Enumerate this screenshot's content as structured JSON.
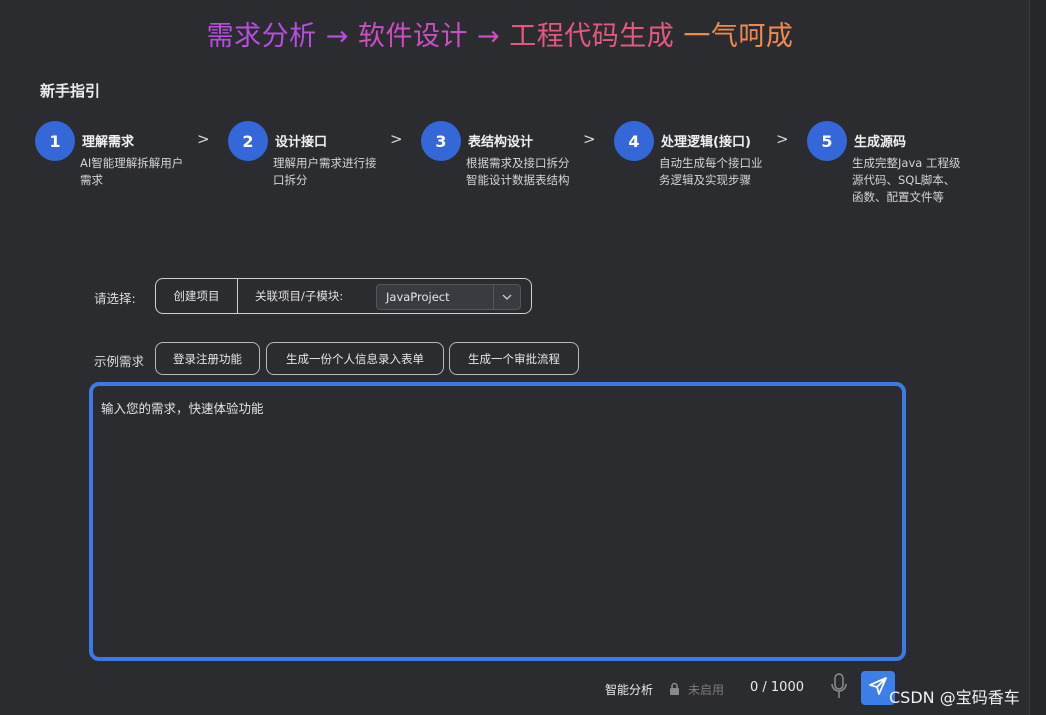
{
  "headline": {
    "part1": "需求分析 → ",
    "part2": "软件设计 → ",
    "part3": "工程代码生成 ",
    "part4": "一气呵成"
  },
  "guide": {
    "title": "新手指引",
    "steps": [
      {
        "num": "1",
        "name": "理解需求",
        "desc": "AI智能理解拆解用户需求"
      },
      {
        "num": "2",
        "name": "设计接口",
        "desc": "理解用户需求进行接口拆分"
      },
      {
        "num": "3",
        "name": "表结构设计",
        "desc": "根据需求及接口拆分智能设计数据表结构"
      },
      {
        "num": "4",
        "name": "处理逻辑(接口)",
        "desc": "自动生成每个接口业务逻辑及实现步骤"
      },
      {
        "num": "5",
        "name": "生成源码",
        "desc": "生成完整Java 工程级源代码、SQL脚本、函数、配置文件等"
      }
    ],
    "arrow": ">"
  },
  "select": {
    "label": "请选择:",
    "create_label": "创建项目",
    "link_label": "关联项目/子模块:",
    "dropdown_value": "JavaProject"
  },
  "examples": {
    "label": "示例需求",
    "chips": [
      "登录注册功能",
      "生成一份个人信息录入表单",
      "生成一个审批流程"
    ]
  },
  "prompt": {
    "placeholder": "输入您的需求，快速体验功能"
  },
  "footer": {
    "smart_label": "智能分析",
    "disabled_label": "未启用",
    "count": "0 / 1000"
  },
  "watermark": "CSDN @宝码香车",
  "colors": {
    "accent": "#3c7ae6",
    "step_circle": "#3468d8",
    "background": "#2b2c30"
  },
  "icons": [
    "lock-icon",
    "microphone-icon",
    "send-icon",
    "chevron-down-icon"
  ]
}
